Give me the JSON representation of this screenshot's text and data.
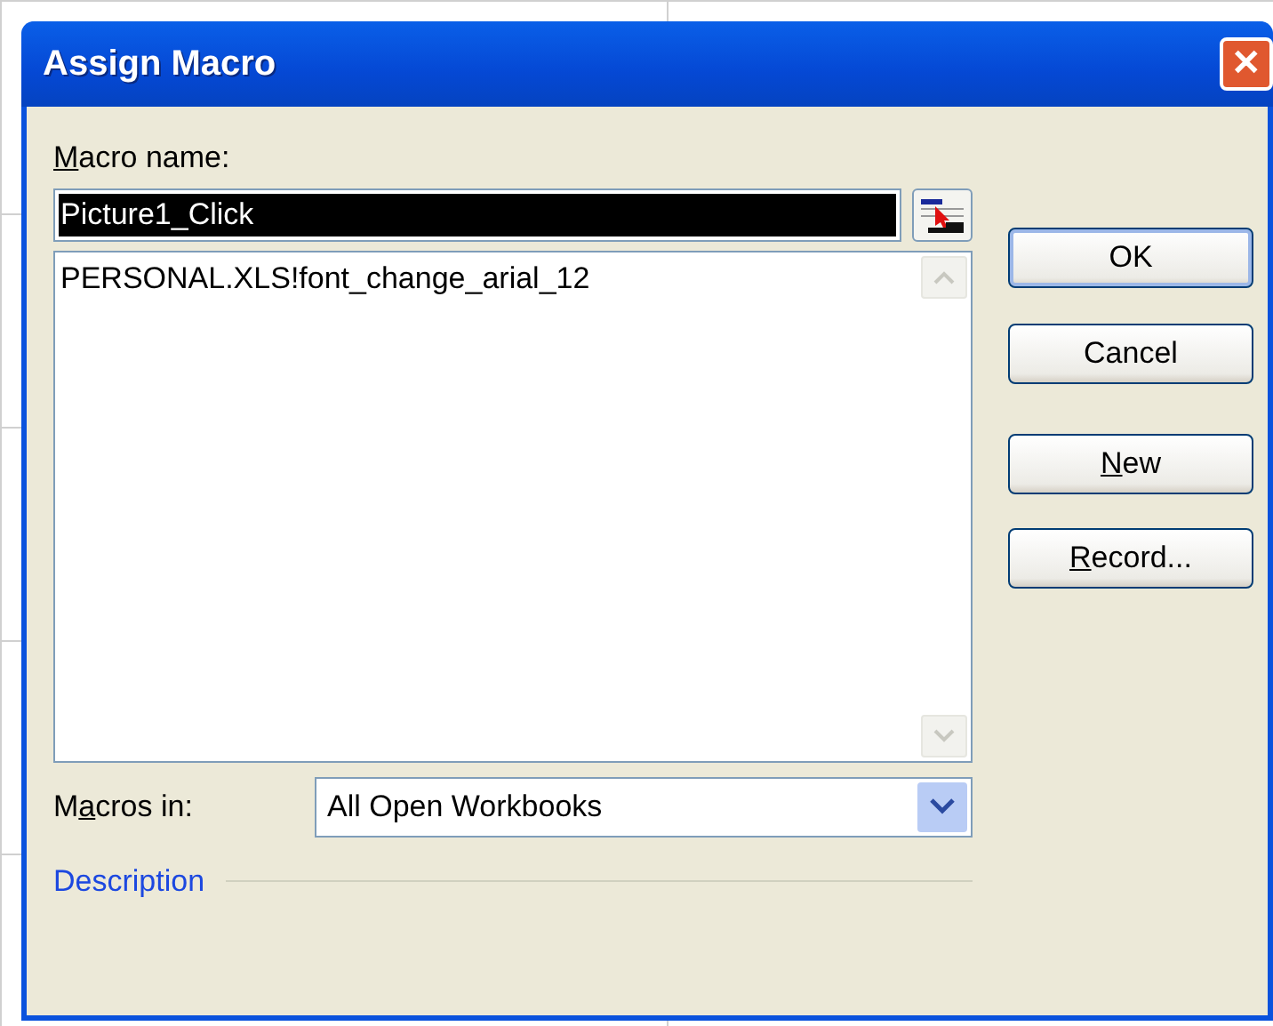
{
  "window": {
    "title": "Assign Macro",
    "close_symbol": "✕"
  },
  "macro_name": {
    "label": [
      {
        "text": "M",
        "underlined": true
      },
      {
        "text": "acro name:",
        "underlined": false
      }
    ],
    "value": "Picture1_Click",
    "text_selected": true
  },
  "macro_list": {
    "items": [
      {
        "label": "PERSONAL.XLS!font_change_arial_12",
        "selected": false
      }
    ]
  },
  "macros_in": {
    "label": [
      {
        "text": "M",
        "underlined": false
      },
      {
        "text": "a",
        "underlined": true
      },
      {
        "text": "cros in:",
        "underlined": false
      }
    ],
    "value": "All Open Workbooks"
  },
  "description": {
    "label": "Description"
  },
  "buttons": [
    {
      "label": [
        {
          "text": "OK",
          "underlined": false
        }
      ],
      "default": true
    },
    {
      "label": [
        {
          "text": "Cancel",
          "underlined": false
        }
      ],
      "default": false
    },
    {
      "label": [
        {
          "text": "N",
          "underlined": true
        },
        {
          "text": "ew",
          "underlined": false
        }
      ],
      "default": false
    },
    {
      "label": [
        {
          "text": "R",
          "underlined": true
        },
        {
          "text": "ecord...",
          "underlined": false
        }
      ],
      "default": false
    }
  ]
}
